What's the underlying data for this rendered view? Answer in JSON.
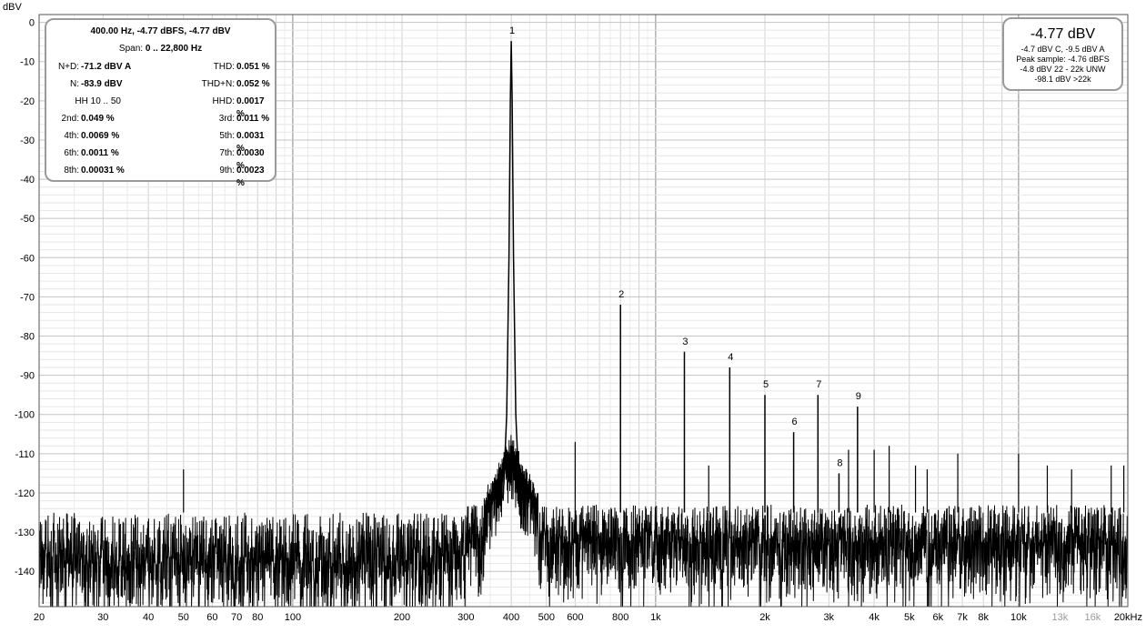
{
  "chart_data": {
    "type": "line",
    "ylabel": "dBV",
    "xscale": "log",
    "xlim": [
      20,
      20000
    ],
    "ylim": [
      -149,
      2
    ],
    "y_ticks": [
      0,
      -10,
      -20,
      -30,
      -40,
      -50,
      -60,
      -70,
      -80,
      -90,
      -100,
      -110,
      -120,
      -130,
      -140
    ],
    "x_ticks": [
      {
        "value": 20,
        "label": "20"
      },
      {
        "value": 30,
        "label": "30"
      },
      {
        "value": 40,
        "label": "40"
      },
      {
        "value": 50,
        "label": "50"
      },
      {
        "value": 60,
        "label": "60"
      },
      {
        "value": 70,
        "label": "70"
      },
      {
        "value": 80,
        "label": "80"
      },
      {
        "value": 100,
        "label": "100"
      },
      {
        "value": 200,
        "label": "200"
      },
      {
        "value": 300,
        "label": "300"
      },
      {
        "value": 400,
        "label": "400"
      },
      {
        "value": 500,
        "label": "500"
      },
      {
        "value": 600,
        "label": "600"
      },
      {
        "value": 800,
        "label": "800"
      },
      {
        "value": 1000,
        "label": "1k"
      },
      {
        "value": 2000,
        "label": "2k"
      },
      {
        "value": 3000,
        "label": "3k"
      },
      {
        "value": 4000,
        "label": "4k"
      },
      {
        "value": 5000,
        "label": "5k"
      },
      {
        "value": 6000,
        "label": "6k"
      },
      {
        "value": 7000,
        "label": "7k"
      },
      {
        "value": 8000,
        "label": "8k"
      },
      {
        "value": 10000,
        "label": "10k"
      },
      {
        "value": 13000,
        "label": "13k",
        "color": "#9a9a9a"
      },
      {
        "value": 16000,
        "label": "16k",
        "color": "#9a9a9a"
      },
      {
        "value": 20000,
        "label": "20kHz"
      }
    ],
    "series": [
      {
        "harmonics": [
          {
            "label": "1",
            "x": 400,
            "y": -4.77
          },
          {
            "label": "2",
            "x": 800,
            "y": -72
          },
          {
            "label": "3",
            "x": 1200,
            "y": -84
          },
          {
            "label": "4",
            "x": 1600,
            "y": -88
          },
          {
            "label": "5",
            "x": 2000,
            "y": -95
          },
          {
            "label": "6",
            "x": 2400,
            "y": -104.5
          },
          {
            "label": "7",
            "x": 2800,
            "y": -95
          },
          {
            "label": "8",
            "x": 3200,
            "y": -115
          },
          {
            "label": "9",
            "x": 3600,
            "y": -98
          }
        ],
        "spurs": [
          {
            "x": 600,
            "y": -107
          },
          {
            "x": 1400,
            "y": -113
          },
          {
            "x": 3400,
            "y": -109
          },
          {
            "x": 4000,
            "y": -109
          },
          {
            "x": 4400,
            "y": -108
          },
          {
            "x": 5200,
            "y": -113
          },
          {
            "x": 5600,
            "y": -114
          },
          {
            "x": 6800,
            "y": -110
          },
          {
            "x": 10000,
            "y": -110
          },
          {
            "x": 12000,
            "y": -113
          },
          {
            "x": 14000,
            "y": -114
          },
          {
            "x": 18000,
            "y": -113
          },
          {
            "x": 19500,
            "y": -113
          },
          {
            "x": 50,
            "y": -114
          }
        ],
        "noise_floor_db": -128
      }
    ]
  },
  "stats_panel": {
    "header": "400.00 Hz, -4.77 dBFS, -4.77 dBV",
    "span_label": "Span:",
    "span_value": "0 .. 22,800 Hz",
    "rows": [
      {
        "l_label": "N+D:",
        "l_value": "-71.2 dBV A",
        "r_label": "THD:",
        "r_value": "0.051 %"
      },
      {
        "l_label": "N:",
        "l_value": "-83.9 dBV",
        "r_label": "THD+N:",
        "r_value": "0.052 %"
      },
      {
        "l_label": "",
        "l_value": "",
        "r_label": "HHD:",
        "r_value": "0.0017 %"
      },
      {
        "l_label": "2nd:",
        "l_value": "0.049 %",
        "r_label": "3rd:",
        "r_value": "0.011 %"
      },
      {
        "l_label": "4th:",
        "l_value": "0.0069 %",
        "r_label": "5th:",
        "r_value": "0.0031 %"
      },
      {
        "l_label": "6th:",
        "l_value": "0.0011 %",
        "r_label": "7th:",
        "r_value": "0.0030 %"
      },
      {
        "l_label": "8th:",
        "l_value": "0.00031 %",
        "r_label": "9th:",
        "r_value": "0.0023 %"
      }
    ],
    "hh_text": "HH 10 .. 50"
  },
  "level_panel": {
    "main": "-4.77 dBV",
    "lines": [
      "-4.7 dBV C, -9.5 dBV A",
      "Peak sample: -4.76 dBFS",
      "-4.8 dBV 22 - 22k UNW",
      "-98.1 dBV >22k"
    ]
  }
}
